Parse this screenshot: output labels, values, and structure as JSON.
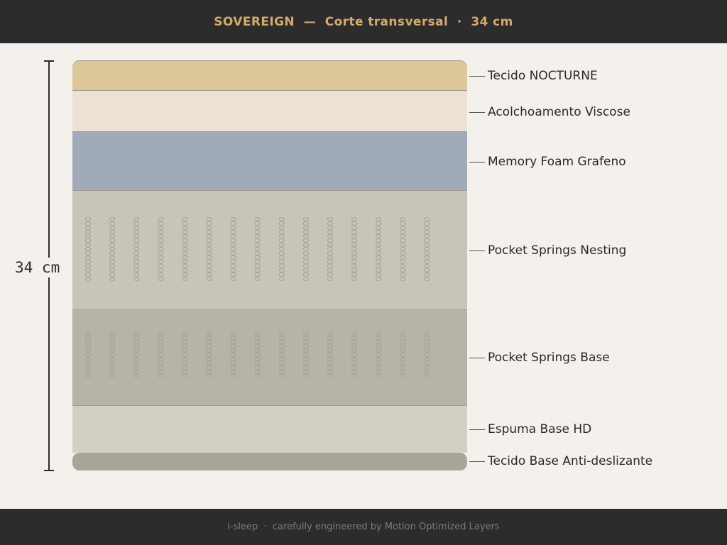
{
  "header": {
    "title": "SOVEREIGN  —  Corte transversal  ·  34 cm"
  },
  "dimension": {
    "label": "34 cm"
  },
  "layers": [
    {
      "name": "Tecido NOCTURNE",
      "color": "#dcc79b"
    },
    {
      "name": "Acolchoamento Viscose",
      "color": "#ebe1d4"
    },
    {
      "name": "Memory Foam Grafeno",
      "color": "#a0aab9"
    },
    {
      "name": "Pocket Springs Nesting",
      "color": "#c8c4b9",
      "springs": true
    },
    {
      "name": "Pocket Springs Base",
      "color": "#b7b3a8",
      "springs": true
    },
    {
      "name": "Espuma Base HD",
      "color": "#d3cfc4"
    },
    {
      "name": "Tecido Base Anti-deslizante",
      "color": "#a9a599"
    }
  ],
  "footer": {
    "text": "i-sleep  ·  carefully engineered by Motion Optimized Layers"
  }
}
